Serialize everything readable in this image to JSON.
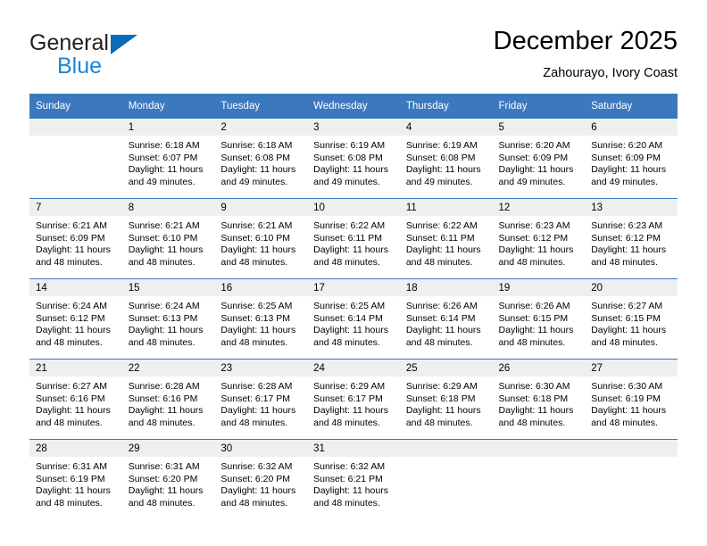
{
  "logo": {
    "primary_text": "General",
    "secondary_text": "Blue",
    "primary_color": "#231f20",
    "secondary_color": "#1a86d8",
    "triangle_color": "#0a6bb8"
  },
  "header": {
    "title": "December 2025",
    "subtitle": "Zahourayo, Ivory Coast"
  },
  "theme": {
    "header_bg": "#3b78bd",
    "daynum_bg": "#efefef",
    "cell_bg": "#ffffff",
    "text": "#000000"
  },
  "weekday_headers": [
    "Sunday",
    "Monday",
    "Tuesday",
    "Wednesday",
    "Thursday",
    "Friday",
    "Saturday"
  ],
  "weeks": [
    [
      {
        "day": "",
        "sunrise": "",
        "sunset": "",
        "daylight_line1": "",
        "daylight_line2": ""
      },
      {
        "day": "1",
        "sunrise": "Sunrise: 6:18 AM",
        "sunset": "Sunset: 6:07 PM",
        "daylight_line1": "Daylight: 11 hours",
        "daylight_line2": "and 49 minutes."
      },
      {
        "day": "2",
        "sunrise": "Sunrise: 6:18 AM",
        "sunset": "Sunset: 6:08 PM",
        "daylight_line1": "Daylight: 11 hours",
        "daylight_line2": "and 49 minutes."
      },
      {
        "day": "3",
        "sunrise": "Sunrise: 6:19 AM",
        "sunset": "Sunset: 6:08 PM",
        "daylight_line1": "Daylight: 11 hours",
        "daylight_line2": "and 49 minutes."
      },
      {
        "day": "4",
        "sunrise": "Sunrise: 6:19 AM",
        "sunset": "Sunset: 6:08 PM",
        "daylight_line1": "Daylight: 11 hours",
        "daylight_line2": "and 49 minutes."
      },
      {
        "day": "5",
        "sunrise": "Sunrise: 6:20 AM",
        "sunset": "Sunset: 6:09 PM",
        "daylight_line1": "Daylight: 11 hours",
        "daylight_line2": "and 49 minutes."
      },
      {
        "day": "6",
        "sunrise": "Sunrise: 6:20 AM",
        "sunset": "Sunset: 6:09 PM",
        "daylight_line1": "Daylight: 11 hours",
        "daylight_line2": "and 49 minutes."
      }
    ],
    [
      {
        "day": "7",
        "sunrise": "Sunrise: 6:21 AM",
        "sunset": "Sunset: 6:09 PM",
        "daylight_line1": "Daylight: 11 hours",
        "daylight_line2": "and 48 minutes."
      },
      {
        "day": "8",
        "sunrise": "Sunrise: 6:21 AM",
        "sunset": "Sunset: 6:10 PM",
        "daylight_line1": "Daylight: 11 hours",
        "daylight_line2": "and 48 minutes."
      },
      {
        "day": "9",
        "sunrise": "Sunrise: 6:21 AM",
        "sunset": "Sunset: 6:10 PM",
        "daylight_line1": "Daylight: 11 hours",
        "daylight_line2": "and 48 minutes."
      },
      {
        "day": "10",
        "sunrise": "Sunrise: 6:22 AM",
        "sunset": "Sunset: 6:11 PM",
        "daylight_line1": "Daylight: 11 hours",
        "daylight_line2": "and 48 minutes."
      },
      {
        "day": "11",
        "sunrise": "Sunrise: 6:22 AM",
        "sunset": "Sunset: 6:11 PM",
        "daylight_line1": "Daylight: 11 hours",
        "daylight_line2": "and 48 minutes."
      },
      {
        "day": "12",
        "sunrise": "Sunrise: 6:23 AM",
        "sunset": "Sunset: 6:12 PM",
        "daylight_line1": "Daylight: 11 hours",
        "daylight_line2": "and 48 minutes."
      },
      {
        "day": "13",
        "sunrise": "Sunrise: 6:23 AM",
        "sunset": "Sunset: 6:12 PM",
        "daylight_line1": "Daylight: 11 hours",
        "daylight_line2": "and 48 minutes."
      }
    ],
    [
      {
        "day": "14",
        "sunrise": "Sunrise: 6:24 AM",
        "sunset": "Sunset: 6:12 PM",
        "daylight_line1": "Daylight: 11 hours",
        "daylight_line2": "and 48 minutes."
      },
      {
        "day": "15",
        "sunrise": "Sunrise: 6:24 AM",
        "sunset": "Sunset: 6:13 PM",
        "daylight_line1": "Daylight: 11 hours",
        "daylight_line2": "and 48 minutes."
      },
      {
        "day": "16",
        "sunrise": "Sunrise: 6:25 AM",
        "sunset": "Sunset: 6:13 PM",
        "daylight_line1": "Daylight: 11 hours",
        "daylight_line2": "and 48 minutes."
      },
      {
        "day": "17",
        "sunrise": "Sunrise: 6:25 AM",
        "sunset": "Sunset: 6:14 PM",
        "daylight_line1": "Daylight: 11 hours",
        "daylight_line2": "and 48 minutes."
      },
      {
        "day": "18",
        "sunrise": "Sunrise: 6:26 AM",
        "sunset": "Sunset: 6:14 PM",
        "daylight_line1": "Daylight: 11 hours",
        "daylight_line2": "and 48 minutes."
      },
      {
        "day": "19",
        "sunrise": "Sunrise: 6:26 AM",
        "sunset": "Sunset: 6:15 PM",
        "daylight_line1": "Daylight: 11 hours",
        "daylight_line2": "and 48 minutes."
      },
      {
        "day": "20",
        "sunrise": "Sunrise: 6:27 AM",
        "sunset": "Sunset: 6:15 PM",
        "daylight_line1": "Daylight: 11 hours",
        "daylight_line2": "and 48 minutes."
      }
    ],
    [
      {
        "day": "21",
        "sunrise": "Sunrise: 6:27 AM",
        "sunset": "Sunset: 6:16 PM",
        "daylight_line1": "Daylight: 11 hours",
        "daylight_line2": "and 48 minutes."
      },
      {
        "day": "22",
        "sunrise": "Sunrise: 6:28 AM",
        "sunset": "Sunset: 6:16 PM",
        "daylight_line1": "Daylight: 11 hours",
        "daylight_line2": "and 48 minutes."
      },
      {
        "day": "23",
        "sunrise": "Sunrise: 6:28 AM",
        "sunset": "Sunset: 6:17 PM",
        "daylight_line1": "Daylight: 11 hours",
        "daylight_line2": "and 48 minutes."
      },
      {
        "day": "24",
        "sunrise": "Sunrise: 6:29 AM",
        "sunset": "Sunset: 6:17 PM",
        "daylight_line1": "Daylight: 11 hours",
        "daylight_line2": "and 48 minutes."
      },
      {
        "day": "25",
        "sunrise": "Sunrise: 6:29 AM",
        "sunset": "Sunset: 6:18 PM",
        "daylight_line1": "Daylight: 11 hours",
        "daylight_line2": "and 48 minutes."
      },
      {
        "day": "26",
        "sunrise": "Sunrise: 6:30 AM",
        "sunset": "Sunset: 6:18 PM",
        "daylight_line1": "Daylight: 11 hours",
        "daylight_line2": "and 48 minutes."
      },
      {
        "day": "27",
        "sunrise": "Sunrise: 6:30 AM",
        "sunset": "Sunset: 6:19 PM",
        "daylight_line1": "Daylight: 11 hours",
        "daylight_line2": "and 48 minutes."
      }
    ],
    [
      {
        "day": "28",
        "sunrise": "Sunrise: 6:31 AM",
        "sunset": "Sunset: 6:19 PM",
        "daylight_line1": "Daylight: 11 hours",
        "daylight_line2": "and 48 minutes."
      },
      {
        "day": "29",
        "sunrise": "Sunrise: 6:31 AM",
        "sunset": "Sunset: 6:20 PM",
        "daylight_line1": "Daylight: 11 hours",
        "daylight_line2": "and 48 minutes."
      },
      {
        "day": "30",
        "sunrise": "Sunrise: 6:32 AM",
        "sunset": "Sunset: 6:20 PM",
        "daylight_line1": "Daylight: 11 hours",
        "daylight_line2": "and 48 minutes."
      },
      {
        "day": "31",
        "sunrise": "Sunrise: 6:32 AM",
        "sunset": "Sunset: 6:21 PM",
        "daylight_line1": "Daylight: 11 hours",
        "daylight_line2": "and 48 minutes."
      },
      {
        "day": "",
        "sunrise": "",
        "sunset": "",
        "daylight_line1": "",
        "daylight_line2": ""
      },
      {
        "day": "",
        "sunrise": "",
        "sunset": "",
        "daylight_line1": "",
        "daylight_line2": ""
      },
      {
        "day": "",
        "sunrise": "",
        "sunset": "",
        "daylight_line1": "",
        "daylight_line2": ""
      }
    ]
  ]
}
